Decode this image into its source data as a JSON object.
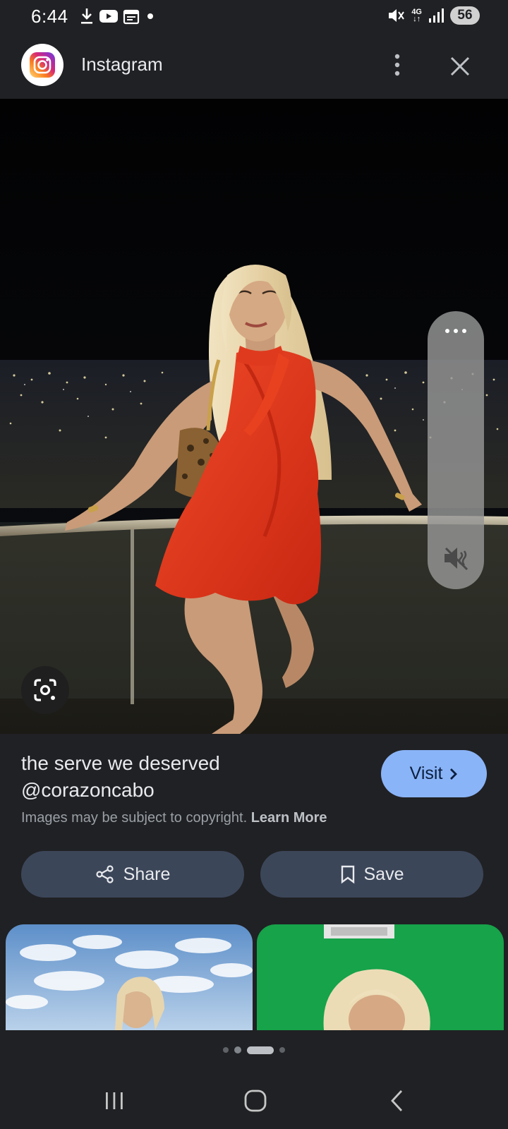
{
  "status_bar": {
    "time": "6:44",
    "network": "4G",
    "battery": "56",
    "icons_left": [
      "download-icon",
      "youtube-icon",
      "calendar-icon",
      "notification-dot"
    ],
    "icons_right": [
      "mute-icon",
      "network-4g-icon",
      "signal-icon",
      "battery-icon"
    ]
  },
  "header": {
    "app_name": "Instagram",
    "logo_icon": "instagram-icon",
    "more_icon": "more-vert-icon",
    "close_icon": "close-icon"
  },
  "main_image": {
    "side_panel_icons": [
      "more-horiz-icon",
      "volume-mute-icon"
    ],
    "lens_icon": "google-lens-icon"
  },
  "info": {
    "caption_line1": "the serve we deserved",
    "caption_line2": "@corazoncabo",
    "copyright_text": "Images may be subject to copyright.",
    "learn_more": "Learn More",
    "visit_label": "Visit"
  },
  "actions": {
    "share_label": "Share",
    "save_label": "Save"
  },
  "pagination": {
    "total": 4,
    "active_index": 2
  },
  "nav": {
    "recents_icon": "recents-icon",
    "home_icon": "home-icon",
    "back_icon": "back-icon"
  },
  "colors": {
    "background": "#202124",
    "visit_button": "#8ab4f8",
    "action_button": "#3c4659",
    "dress": "#e8341c",
    "thumb_green": "#16a34a"
  }
}
